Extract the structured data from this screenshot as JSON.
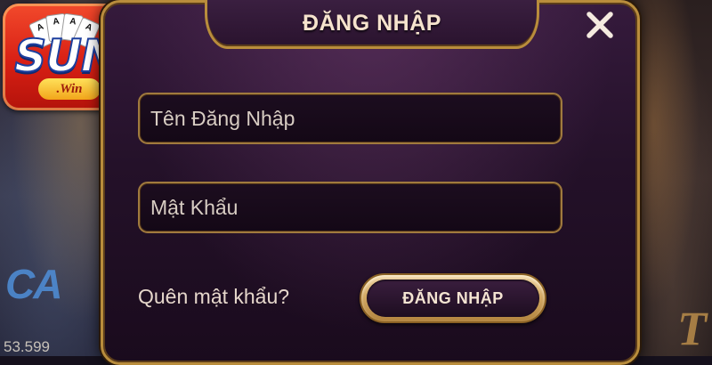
{
  "dialog": {
    "title": "ĐĂNG NHẬP",
    "close_icon": "close-icon"
  },
  "form": {
    "username": {
      "placeholder": "Tên Đăng Nhập",
      "value": ""
    },
    "password": {
      "placeholder": "Mật Khẩu",
      "value": ""
    },
    "forgot_link": "Quên mật khẩu?",
    "submit_label": "ĐĂNG NHẬP"
  },
  "logo": {
    "brand": "SUN",
    "sub": ".Win",
    "cards": [
      "A",
      "A",
      "A",
      "A"
    ]
  },
  "background": {
    "left_text": "CA",
    "left_number": "53.599",
    "right_text": "T"
  },
  "colors": {
    "gold_border": "#b98d3c",
    "panel_bg": "#241129",
    "text": "#e6d7cb",
    "logo_red": "#d81f14"
  }
}
